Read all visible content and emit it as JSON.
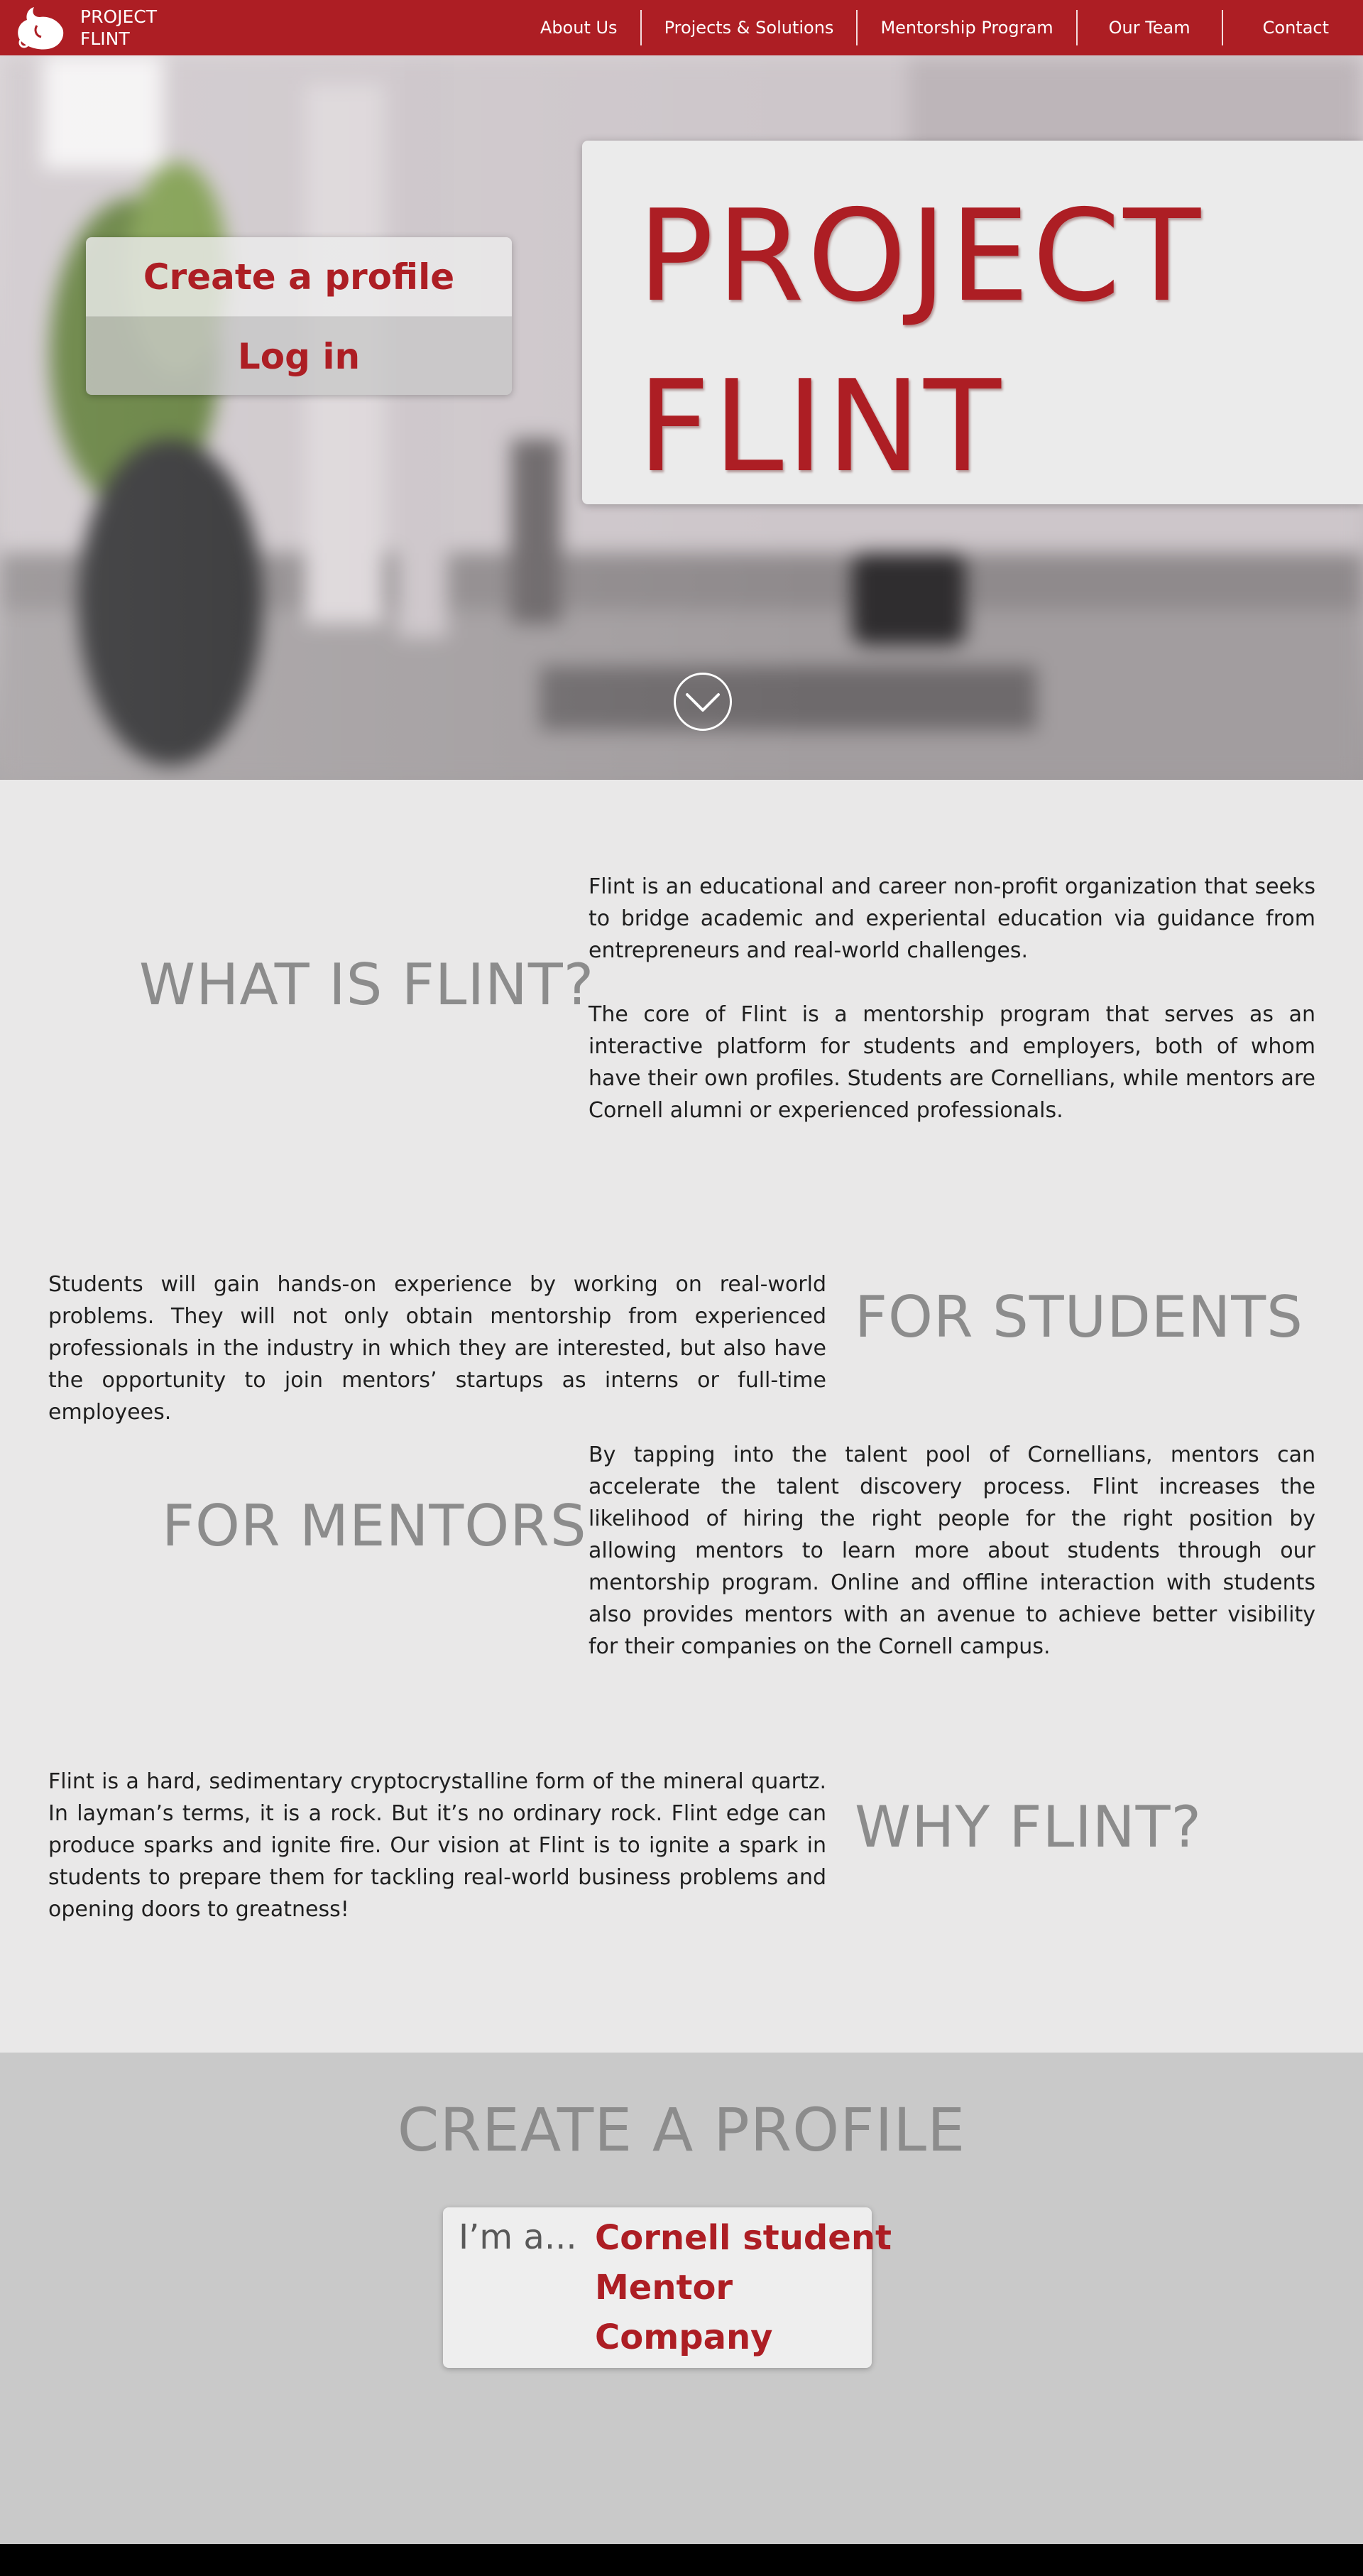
{
  "colors": {
    "brand_red": "#ad1e24",
    "heading_gray": "#8c8c8c",
    "section_bg": "#e9e8e8",
    "profile_bg": "#c9c9c9"
  },
  "nav": {
    "logo_icon": "flint-logo-icon",
    "logo_line1": "PROJECT",
    "logo_line2": "FLINT",
    "links": [
      "About Us",
      "Projects & Solutions",
      "Mentorship Program",
      "Our Team",
      "Contact"
    ]
  },
  "hero": {
    "create_profile": "Create a profile",
    "log_in": "Log in",
    "title_line1": "PROJECT",
    "title_line2": "FLINT",
    "scroll_icon": "chevron-down-icon"
  },
  "what": {
    "heading": "WHAT IS FLINT?",
    "para1": "Flint is an educational and career non-profit organization that seeks to bridge academic and experiental education via guidance from entrepreneurs and real-world challenges.",
    "para2": "The core of Flint is a mentorship program that serves as an interactive platform for students and employers, both of whom have their own profiles. Students are Cornellians, while mentors are Cornell alumni or experienced professionals."
  },
  "students": {
    "heading": "FOR STUDENTS",
    "text": "Students will gain hands-on experience by working on real-world problems. They will not only obtain mentorship from experienced professionals in the industry in which they are interested, but also have the opportunity to join mentors’ startups as interns or full-time employees."
  },
  "mentors": {
    "heading": "FOR MENTORS",
    "text": "By tapping into the talent pool of Cornellians, mentors can accelerate the talent discovery process. Flint increases the likelihood of hiring the right people for the right position by allowing mentors to learn more about students through our mentorship program. Online and offline interaction with students also provides mentors with an avenue to achieve better visibility for their companies on the Cornell campus."
  },
  "why": {
    "heading": "WHY FLINT?",
    "text": "Flint is a hard, sedimentary cryptocrystalline form of the mineral quartz. In layman’s terms, it is a rock. But it’s no ordinary rock. Flint edge can produce sparks and ignite fire. Our vision at Flint is to ignite a spark in students to prepare them for tackling real-world business problems and opening doors to greatness!"
  },
  "create_profile": {
    "heading": "CREATE A PROFILE",
    "prompt": "I’m a...",
    "options": [
      "Cornell student",
      "Mentor",
      "Company"
    ]
  }
}
